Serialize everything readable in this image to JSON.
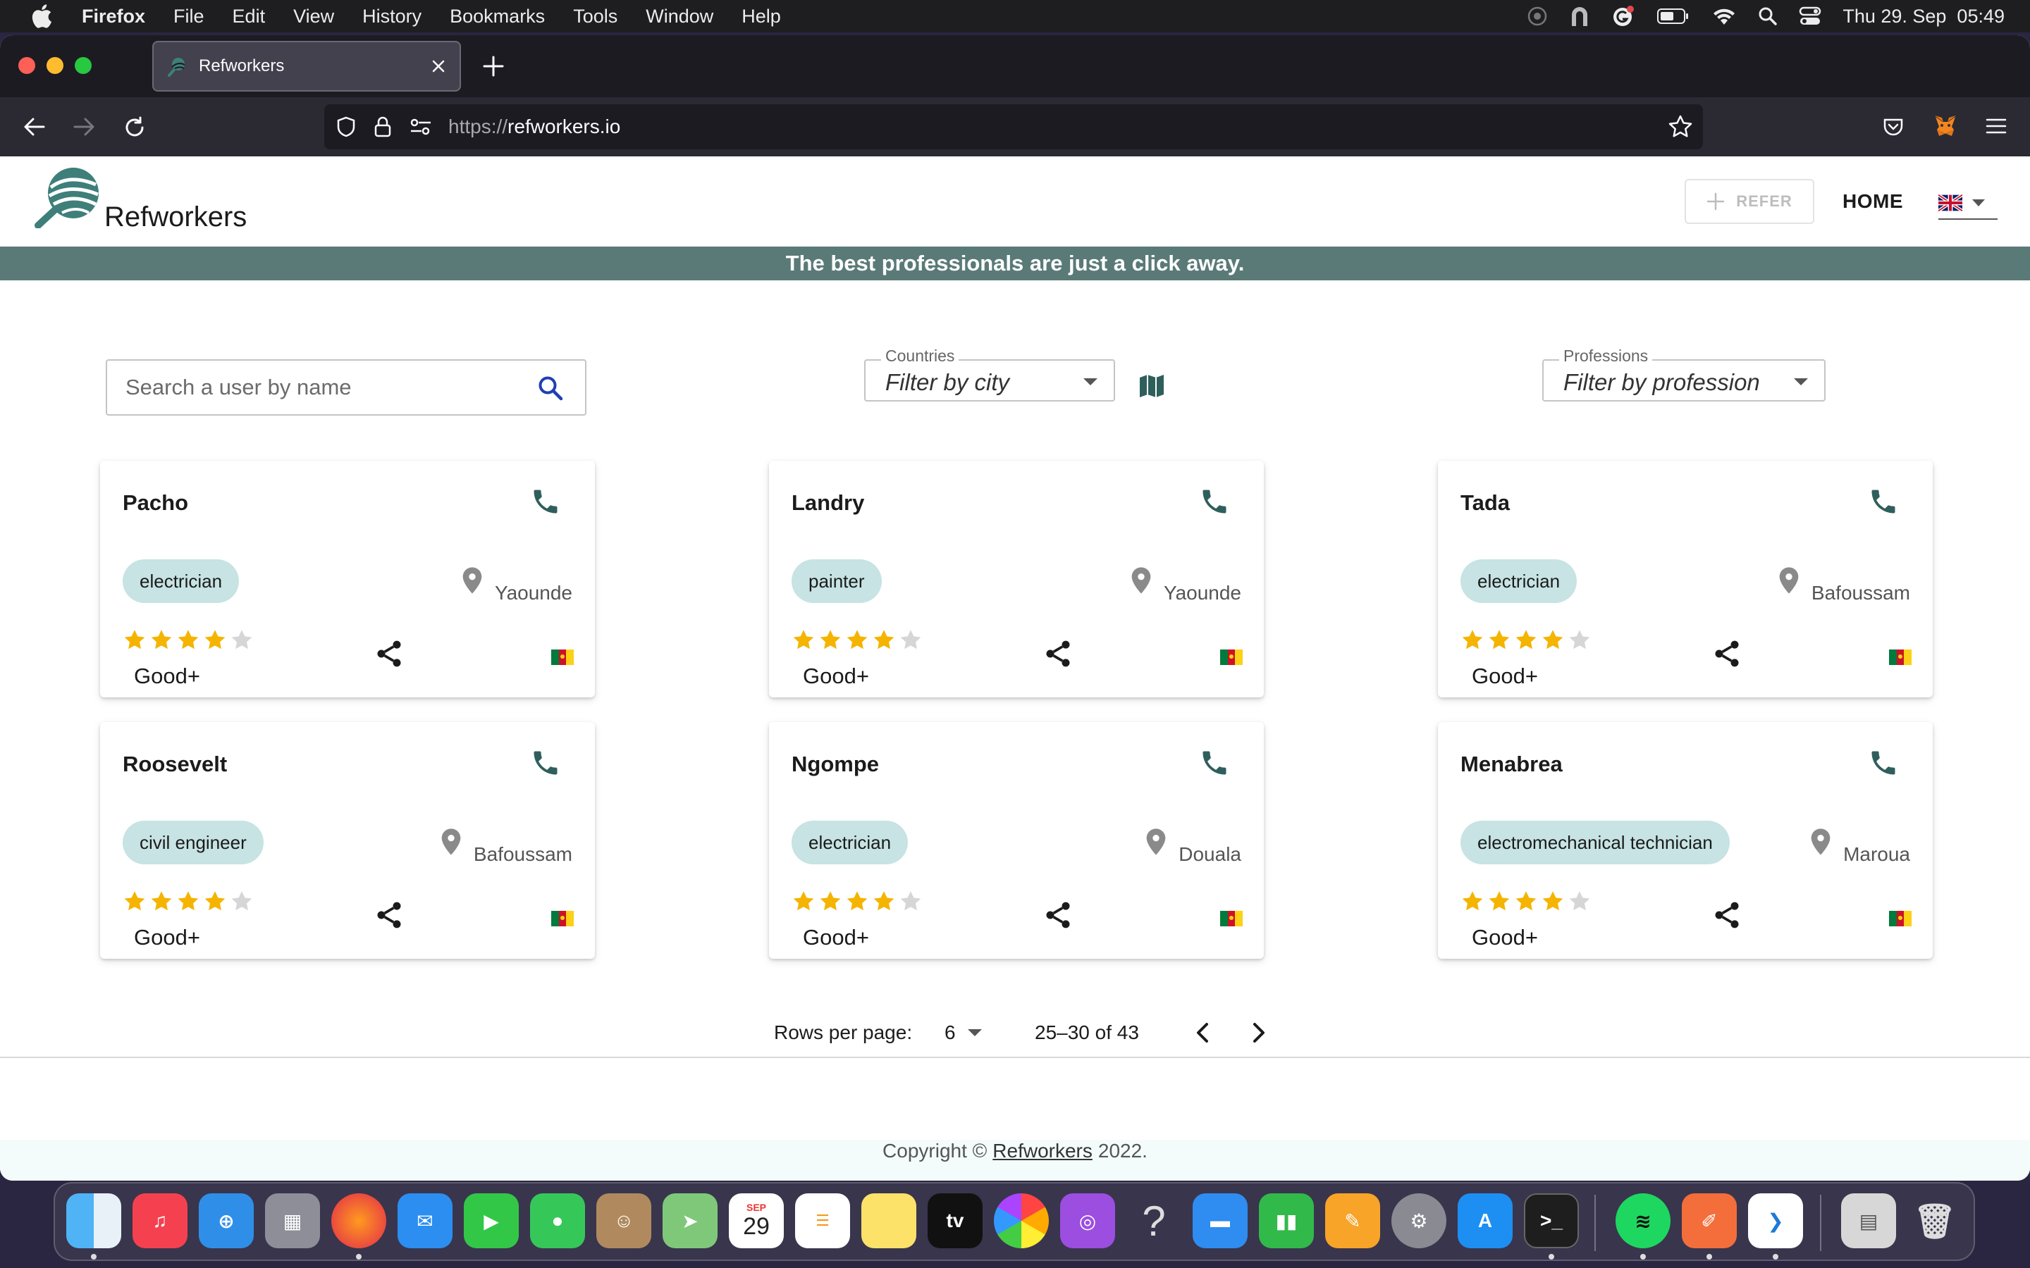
{
  "menubar": {
    "app_name": "Firefox",
    "items": [
      "File",
      "Edit",
      "View",
      "History",
      "Bookmarks",
      "Tools",
      "Window",
      "Help"
    ],
    "datetime": "Thu 29. Sep  05:49"
  },
  "browser": {
    "tab_title": "Refworkers",
    "url_scheme": "https://",
    "url_host": "refworkers.io"
  },
  "header": {
    "brand": "Refworkers",
    "refer_label": "REFER",
    "home_label": "HOME",
    "language_icon": "uk-flag-icon"
  },
  "banner": {
    "text": "The best professionals are just a click away."
  },
  "filters": {
    "search_placeholder": "Search a user by name",
    "countries_label": "Countries",
    "city_placeholder": "Filter by city",
    "professions_label": "Professions",
    "profession_placeholder": "Filter by profession"
  },
  "cards": [
    {
      "name": "Pacho",
      "profession": "electrician",
      "city": "Yaounde",
      "rating_text": "Good+",
      "stars": 4,
      "max_stars": 5
    },
    {
      "name": "Landry",
      "profession": "painter",
      "city": "Yaounde",
      "rating_text": "Good+",
      "stars": 4,
      "max_stars": 5
    },
    {
      "name": "Tada",
      "profession": "electrician",
      "city": "Bafoussam",
      "rating_text": "Good+",
      "stars": 4,
      "max_stars": 5
    },
    {
      "name": "Roosevelt",
      "profession": "civil engineer",
      "city": "Bafoussam",
      "rating_text": "Good+",
      "stars": 4,
      "max_stars": 5
    },
    {
      "name": "Ngompe",
      "profession": "electrician",
      "city": "Douala",
      "rating_text": "Good+",
      "stars": 4,
      "max_stars": 5
    },
    {
      "name": "Menabrea",
      "profession": "electromechanical technician",
      "city": "Maroua",
      "rating_text": "Good+",
      "stars": 4,
      "max_stars": 5
    }
  ],
  "pagination": {
    "rows_label": "Rows per page:",
    "rows_value": "6",
    "range_text": "25–30 of 43"
  },
  "footer": {
    "prefix": "Copyright ©",
    "link": "Refworkers",
    "suffix": "2022."
  },
  "colors": {
    "banner": "#5a7a78",
    "chip": "#c7e3e3",
    "icon_teal": "#2f5f5c",
    "star_filled": "#f4b400",
    "star_empty": "#d6d6d6",
    "search_icon": "#1f3fb3"
  },
  "dock": {
    "calendar_month": "SEP",
    "calendar_day": "29",
    "tv_label": "tv",
    "help_label": "?"
  }
}
